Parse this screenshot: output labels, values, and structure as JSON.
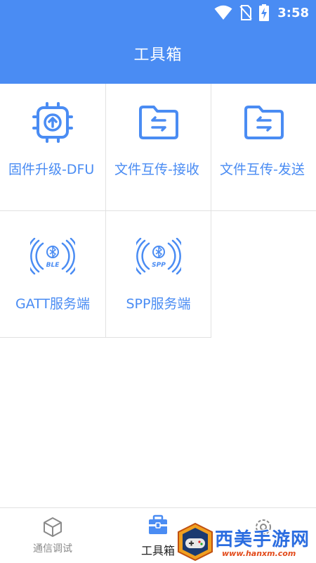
{
  "status_bar": {
    "time": "3:58"
  },
  "header": {
    "title": "工具箱"
  },
  "tools": [
    {
      "label": "固件升级-DFU",
      "icon": "chip-upload-icon"
    },
    {
      "label": "文件互传-接收",
      "icon": "folder-receive-icon"
    },
    {
      "label": "文件互传-发送",
      "icon": "folder-send-icon"
    },
    {
      "label": "GATT服务端",
      "icon": "bluetooth-ble-icon",
      "badge": "BLE"
    },
    {
      "label": "SPP服务端",
      "icon": "bluetooth-spp-icon",
      "badge": "SPP"
    }
  ],
  "bottom_nav": [
    {
      "label": "通信调试",
      "icon": "cube-icon"
    },
    {
      "label": "工具箱",
      "icon": "toolbox-icon",
      "active": true
    },
    {
      "label": "",
      "icon": "settings-icon"
    }
  ],
  "watermark": {
    "text": "西美手游网",
    "url": "www.hanxm.com"
  },
  "colors": {
    "accent": "#4a8cf3",
    "divider": "#e1e1e1",
    "nav_inactive": "#8a8a8a"
  }
}
